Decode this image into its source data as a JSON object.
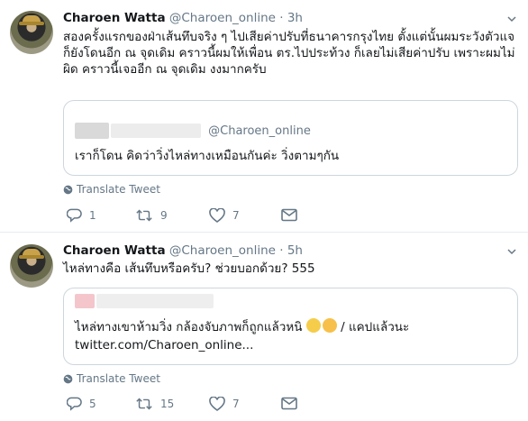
{
  "tweets": [
    {
      "name": "Charoen Watta",
      "handle": "@Charoen_online",
      "dot": "·",
      "time": "3h",
      "text": "สองครั้งแรกของฝ่าเส้นทึบจริง ๆ ไปเสียค่าปรับที่ธนาคารกรุงไทย ตั้งแต่นั้นผมระวังตัวแจ ก็ยังโดนอีก ณ จุดเดิม คราวนี้ผมให้เพื่อน ตร.ไปประท้วง ก็เลยไม่เสียค่าปรับ เพราะผมไม่ผิด คราวนี้เจออีก ณ จุดเดิม งงมากครับ",
      "quote": {
        "handle": "@Charoen_online",
        "text": "เราก็โดน คิดว่าวิ่งไหล่ทางเหมือนกันค่ะ วิ่งตามๆกัน"
      },
      "translate_label": "Translate Tweet",
      "replies": "1",
      "retweets": "9",
      "likes": "7"
    },
    {
      "name": "Charoen Watta",
      "handle": "@Charoen_online",
      "dot": "·",
      "time": "5h",
      "text": "ไหล่ทางคือ เส้นทึบหรือครับ? ช่วยบอกด้วย? 555",
      "quote": {
        "text_line1": "ไหล่ทางเขาห้ามวิ่ง กล้องจับภาพก็ถูกแล้วหนิ",
        "text_line1_tail": "/ แคปแล้วนะ",
        "text_line2": "twitter.com/Charoen_online..."
      },
      "translate_label": "Translate Tweet",
      "replies": "5",
      "retweets": "15",
      "likes": "7"
    }
  ],
  "colors": {
    "text": "#14171a",
    "secondary": "#657786",
    "border": "#e6ecf0",
    "quote_border": "#ccd6dd"
  },
  "icons": [
    "chevron-down-icon",
    "globe-icon",
    "reply-icon",
    "retweet-icon",
    "heart-icon",
    "message-icon",
    "emoji-icon"
  ]
}
